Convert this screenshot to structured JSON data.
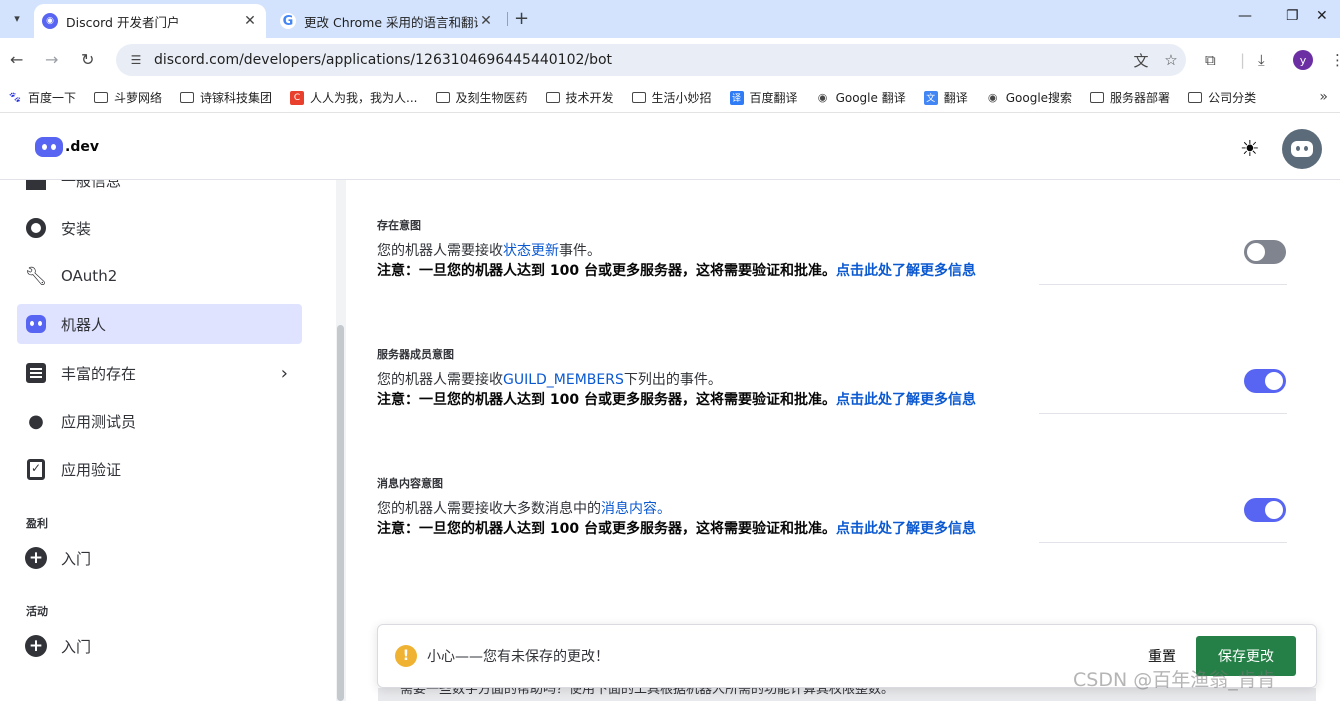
{
  "browser": {
    "tabs": [
      {
        "title": "Discord 开发者门户",
        "favicon": "discord-icon"
      },
      {
        "title": "更改 Chrome 采用的语言和翻译",
        "favicon": "google-icon"
      }
    ],
    "url": "discord.com/developers/applications/1263104696445440102/bot",
    "profile_initial": "y",
    "bookmarks": [
      {
        "label": "百度一下",
        "icon": "baidu-icon"
      },
      {
        "label": "斗萝网络",
        "icon": "folder-icon"
      },
      {
        "label": "诗镓科技集团",
        "icon": "folder-icon"
      },
      {
        "label": "人人为我，我为人...",
        "icon": "c-icon"
      },
      {
        "label": "及刻生物医药",
        "icon": "folder-icon"
      },
      {
        "label": "技术开发",
        "icon": "folder-icon"
      },
      {
        "label": "生活小妙招",
        "icon": "folder-icon"
      },
      {
        "label": "百度翻译",
        "icon": "translate-icon"
      },
      {
        "label": "Google 翻译",
        "icon": "globe-icon"
      },
      {
        "label": "翻译",
        "icon": "google-translate-icon"
      },
      {
        "label": "Google搜索",
        "icon": "globe-icon"
      },
      {
        "label": "服务器部署",
        "icon": "folder-icon"
      },
      {
        "label": "公司分类",
        "icon": "folder-icon"
      }
    ]
  },
  "header": {
    "logo_text": ".dev"
  },
  "sidebar": {
    "items": [
      {
        "label": "一般信息",
        "icon": "home-icon"
      },
      {
        "label": "安装",
        "icon": "gear-icon"
      },
      {
        "label": "OAuth2",
        "icon": "wrench-icon"
      },
      {
        "label": "机器人",
        "icon": "bot-icon",
        "active": true
      },
      {
        "label": "丰富的存在",
        "icon": "list-icon"
      },
      {
        "label": "应用测试员",
        "icon": "person-icon"
      },
      {
        "label": "应用验证",
        "icon": "clipboard-check-icon"
      }
    ],
    "sections": [
      {
        "title": "盈利",
        "item_label": "入门"
      },
      {
        "title": "活动",
        "item_label": "入门"
      }
    ]
  },
  "main": {
    "intents": [
      {
        "title": "存在意图",
        "desc_prefix": "您的机器人需要接收",
        "desc_link": "状态更新",
        "desc_suffix": "事件。",
        "note": "注意：一旦您的机器人达到 100 台或更多服务器，这将需要验证和批准。",
        "note_link": "点击此处了解更多信息",
        "enabled": false
      },
      {
        "title": "服务器成员意图",
        "desc_prefix": "您的机器人需要接收",
        "desc_link": "GUILD_MEMBERS",
        "desc_suffix": "下列出的事件。",
        "note": "注意：一旦您的机器人达到 100 台或更多服务器，这将需要验证和批准。",
        "note_link": "点击此处了解更多信息",
        "enabled": true
      },
      {
        "title": "消息内容意图",
        "desc_prefix": "您的机器人需要接收大多数消息中的",
        "desc_link": "消息内容。",
        "desc_suffix": "",
        "note": "注意：一旦您的机器人达到 100 台或更多服务器，这将需要验证和批准。",
        "note_link": "点击此处了解更多信息",
        "enabled": true
      }
    ]
  },
  "notice": {
    "text": "小心——您有未保存的更改！",
    "reset_label": "重置",
    "save_label": "保存更改",
    "under_text": "需要一些数字方面的帮助吗？使用下面的工具根据机器人所需的功能计算其权限整数。"
  },
  "watermark": "CSDN @百年渔翁_肯肯",
  "colors": {
    "accent": "#5865f2",
    "link": "#0b59d1",
    "save": "#248046",
    "warning": "#f0b232"
  }
}
